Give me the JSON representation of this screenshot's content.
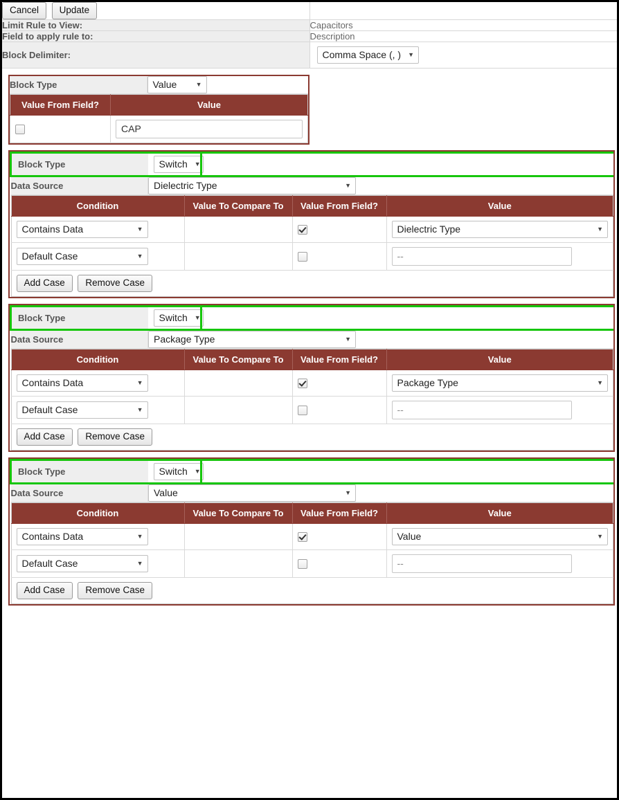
{
  "toolbar": {
    "cancel_label": "Cancel",
    "update_label": "Update"
  },
  "header": {
    "rows": [
      {
        "label": "Limit Rule to View:",
        "value": "Capacitors",
        "type": "text"
      },
      {
        "label": "Field to apply rule to:",
        "value": "Description",
        "type": "text"
      },
      {
        "label": "Block Delimiter:",
        "value": "Comma Space (, )",
        "type": "select"
      }
    ]
  },
  "labels": {
    "block_type": "Block Type",
    "data_source": "Data Source",
    "add_case": "Add Case",
    "remove_case": "Remove Case"
  },
  "value_table_headers": {
    "value_from_field": "Value From Field?",
    "value": "Value"
  },
  "switch_table_headers": {
    "condition": "Condition",
    "value_to_compare_to": "Value To Compare To",
    "value_from_field": "Value From Field?",
    "value": "Value"
  },
  "blocks": [
    {
      "kind": "value",
      "highlighted": false,
      "block_type": "Value",
      "rows": [
        {
          "value_from_field": false,
          "value": "CAP"
        }
      ]
    },
    {
      "kind": "switch",
      "highlighted": true,
      "block_type": "Switch",
      "data_source": "Dielectric Type",
      "cases": [
        {
          "condition": "Contains Data",
          "value_to_compare_to": "",
          "value_from_field": true,
          "value": "Dielectric Type",
          "value_widget": "select"
        },
        {
          "condition": "Default Case",
          "value_to_compare_to": "",
          "value_from_field": false,
          "value": "--",
          "value_widget": "text"
        }
      ]
    },
    {
      "kind": "switch",
      "highlighted": true,
      "block_type": "Switch",
      "data_source": "Package Type",
      "cases": [
        {
          "condition": "Contains Data",
          "value_to_compare_to": "",
          "value_from_field": true,
          "value": "Package Type",
          "value_widget": "select"
        },
        {
          "condition": "Default Case",
          "value_to_compare_to": "",
          "value_from_field": false,
          "value": "--",
          "value_widget": "text"
        }
      ]
    },
    {
      "kind": "switch",
      "highlighted": true,
      "block_type": "Switch",
      "data_source": "Value",
      "cases": [
        {
          "condition": "Contains Data",
          "value_to_compare_to": "",
          "value_from_field": true,
          "value": "Value",
          "value_widget": "select"
        },
        {
          "condition": "Default Case",
          "value_to_compare_to": "",
          "value_from_field": false,
          "value": "--",
          "value_widget": "text"
        }
      ]
    }
  ],
  "icons": {
    "dropdown_caret": "▼"
  },
  "colors": {
    "table_header_bg": "#8b3a31",
    "block_border": "#8b3a31",
    "highlight": "#16c60c",
    "label_bg": "#eeeeee"
  }
}
